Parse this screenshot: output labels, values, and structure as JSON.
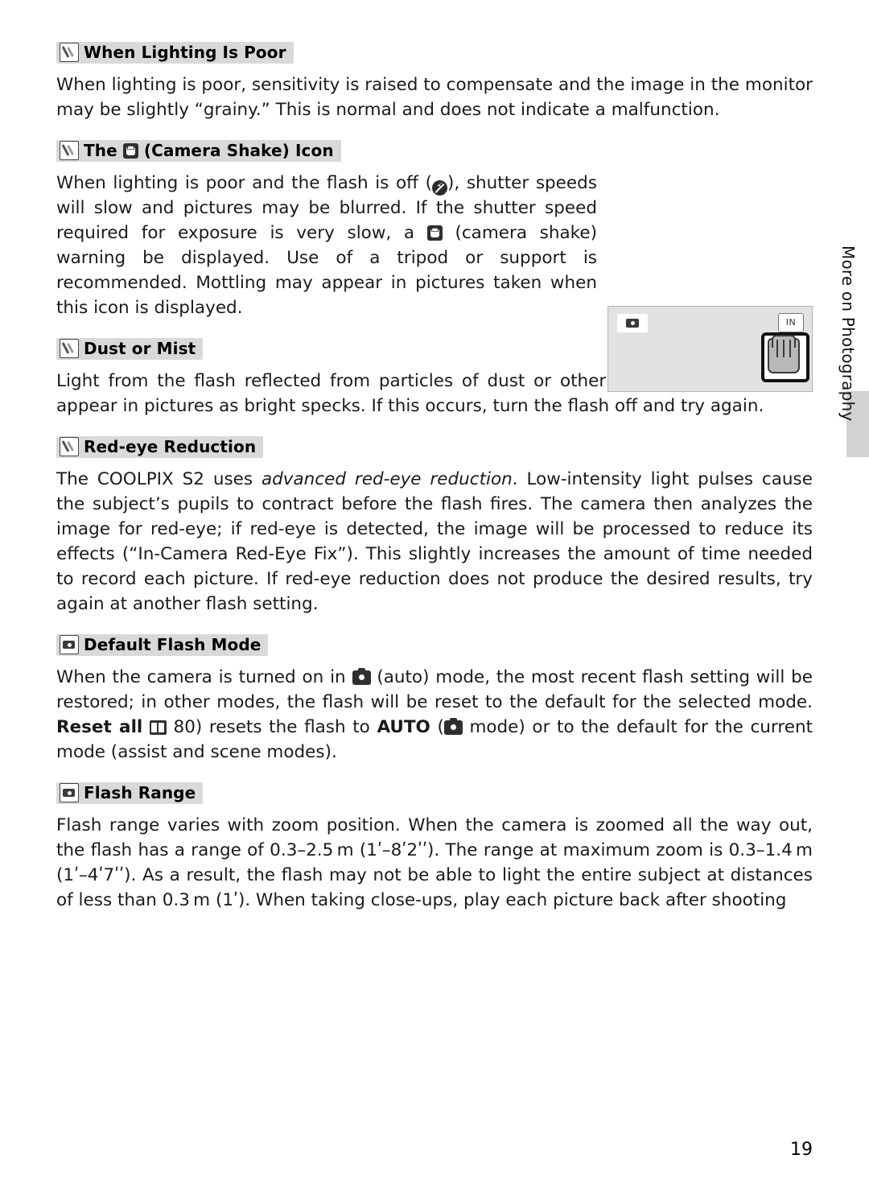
{
  "page": {
    "number": "19",
    "side_tab_label": "More on Photography"
  },
  "sections": [
    {
      "icon": "pencil-note-icon",
      "heading": "When Lighting Is Poor",
      "paragraphs": [
        "When lighting is poor, sensitivity is raised to compensate and the image in the monitor may be slightly “grainy.”  This is normal and does not indicate a malfunction."
      ]
    },
    {
      "icon": "pencil-note-icon",
      "heading_prefix": "The ",
      "heading_suffix": " (Camera Shake) Icon",
      "heading_icon": "camera-shake-hand-icon",
      "paragraph_parts": {
        "p1": "When lighting is poor and the flash is off (",
        "flash_off_icon": "flash-off-icon",
        "p2": "), shutter speeds will slow and pictures may be blurred.  If the shutter speed required for exposure is very slow, a ",
        "shake_icon": "camera-shake-hand-icon",
        "p3": " (camera shake) warning be displayed.  Use of a tripod or support is recommended.  Mottling may appear in pictures taken when this icon is displayed."
      }
    },
    {
      "icon": "pencil-note-icon",
      "heading": "Dust or Mist",
      "paragraphs": [
        "Light from the flash reflected from particles of dust or other matter in the air may appear in pictures as bright specks.  If this occurs, turn the flash off and try again."
      ]
    },
    {
      "icon": "pencil-note-icon",
      "heading": "Red-eye Reduction",
      "paragraph_parts": {
        "p1": "The COOLPIX S2 uses ",
        "italic": "advanced red-eye reduction",
        "p2": ".  Low-intensity light pulses cause the subject’s pupils to contract before the flash fires.  The camera then analyzes the image for red-eye; if red-eye is detected, the image will be processed to reduce its effects (“In-Camera Red-Eye Fix”).  This slightly increases the amount of time needed to record each picture.  If red-eye reduction does not produce the desired results, try again at another flash setting."
      }
    },
    {
      "icon": "camera-note-icon",
      "heading": "Default Flash Mode",
      "paragraph_parts": {
        "p1": "When the camera is turned on in ",
        "auto_icon": "auto-mode-camera-icon",
        "p2": " (auto) mode, the most recent flash setting will be restored; in other modes, the flash will be reset to the default for the selected mode. ",
        "bold1": "Reset all",
        "book_icon": "reference-book-icon",
        "p3": " 80) resets the flash to ",
        "bold2": "AUTO",
        "auto_icon2": "auto-mode-camera-icon",
        "p4": " mode) or to the default for the current mode (assist and scene modes)."
      }
    },
    {
      "icon": "camera-note-icon",
      "heading": "Flash Range",
      "paragraphs": [
        "Flash range varies with zoom position.  When the camera is zoomed all the way out, the flash has a range of 0.3–2.5 m (1ʹ–8ʹ2ʹʹ).  The range at maximum zoom is 0.3–1.4 m (1ʹ–4ʹ7ʹʹ).  As a result, the flash may not be able to light the entire subject at distances of less than 0.3 m (1ʹ).  When taking close-ups, play each picture back after shooting"
      ]
    }
  ],
  "monitor": {
    "mode_icon": "camera-auto-mode-icon",
    "memory_label": "IN",
    "shake_icon": "camera-shake-warning-icon"
  }
}
